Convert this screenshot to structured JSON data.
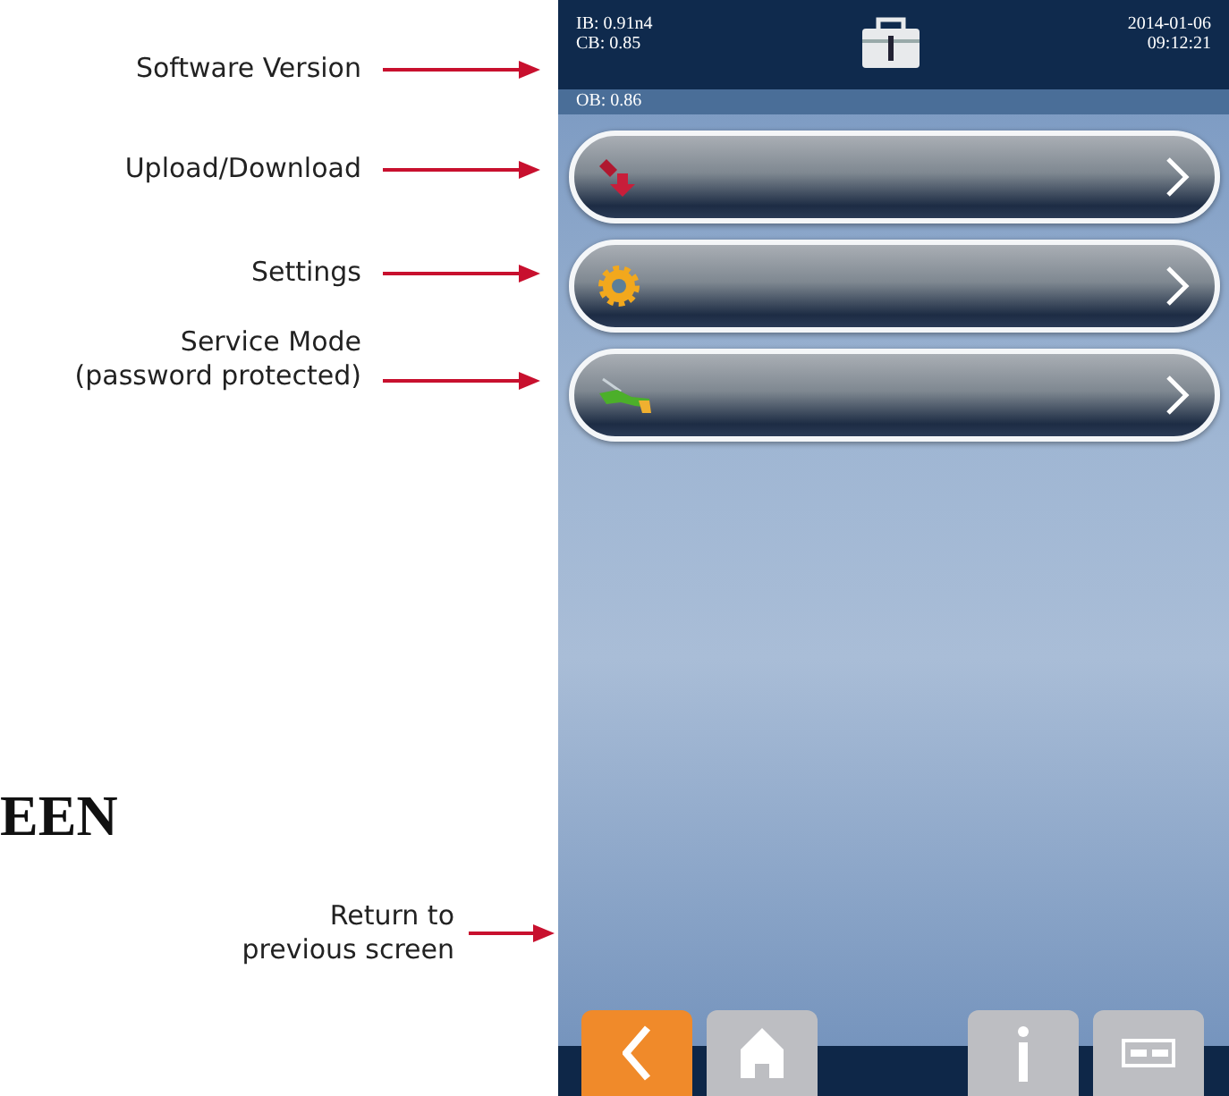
{
  "annotations": [
    {
      "lines": [
        "Software Version"
      ]
    },
    {
      "lines": [
        "Upload/Download"
      ]
    },
    {
      "lines": [
        "Settings"
      ]
    },
    {
      "lines": [
        "Service Mode",
        "(password protected)"
      ]
    }
  ],
  "heading": "EEN",
  "nav_annotation": {
    "lines": [
      "Return to",
      "previous screen"
    ]
  },
  "device": {
    "header": {
      "versions": [
        "IB: 0.91n4",
        "CB: 0.85",
        "OB: 0.86"
      ],
      "date": "2014-01-06",
      "time": "09:12:21"
    },
    "menu": [
      {
        "kind": "transfer"
      },
      {
        "kind": "settings"
      },
      {
        "kind": "service"
      }
    ],
    "nav": [
      {
        "kind": "back"
      },
      {
        "kind": "home"
      },
      {
        "kind": "info"
      },
      {
        "kind": "card"
      }
    ]
  }
}
